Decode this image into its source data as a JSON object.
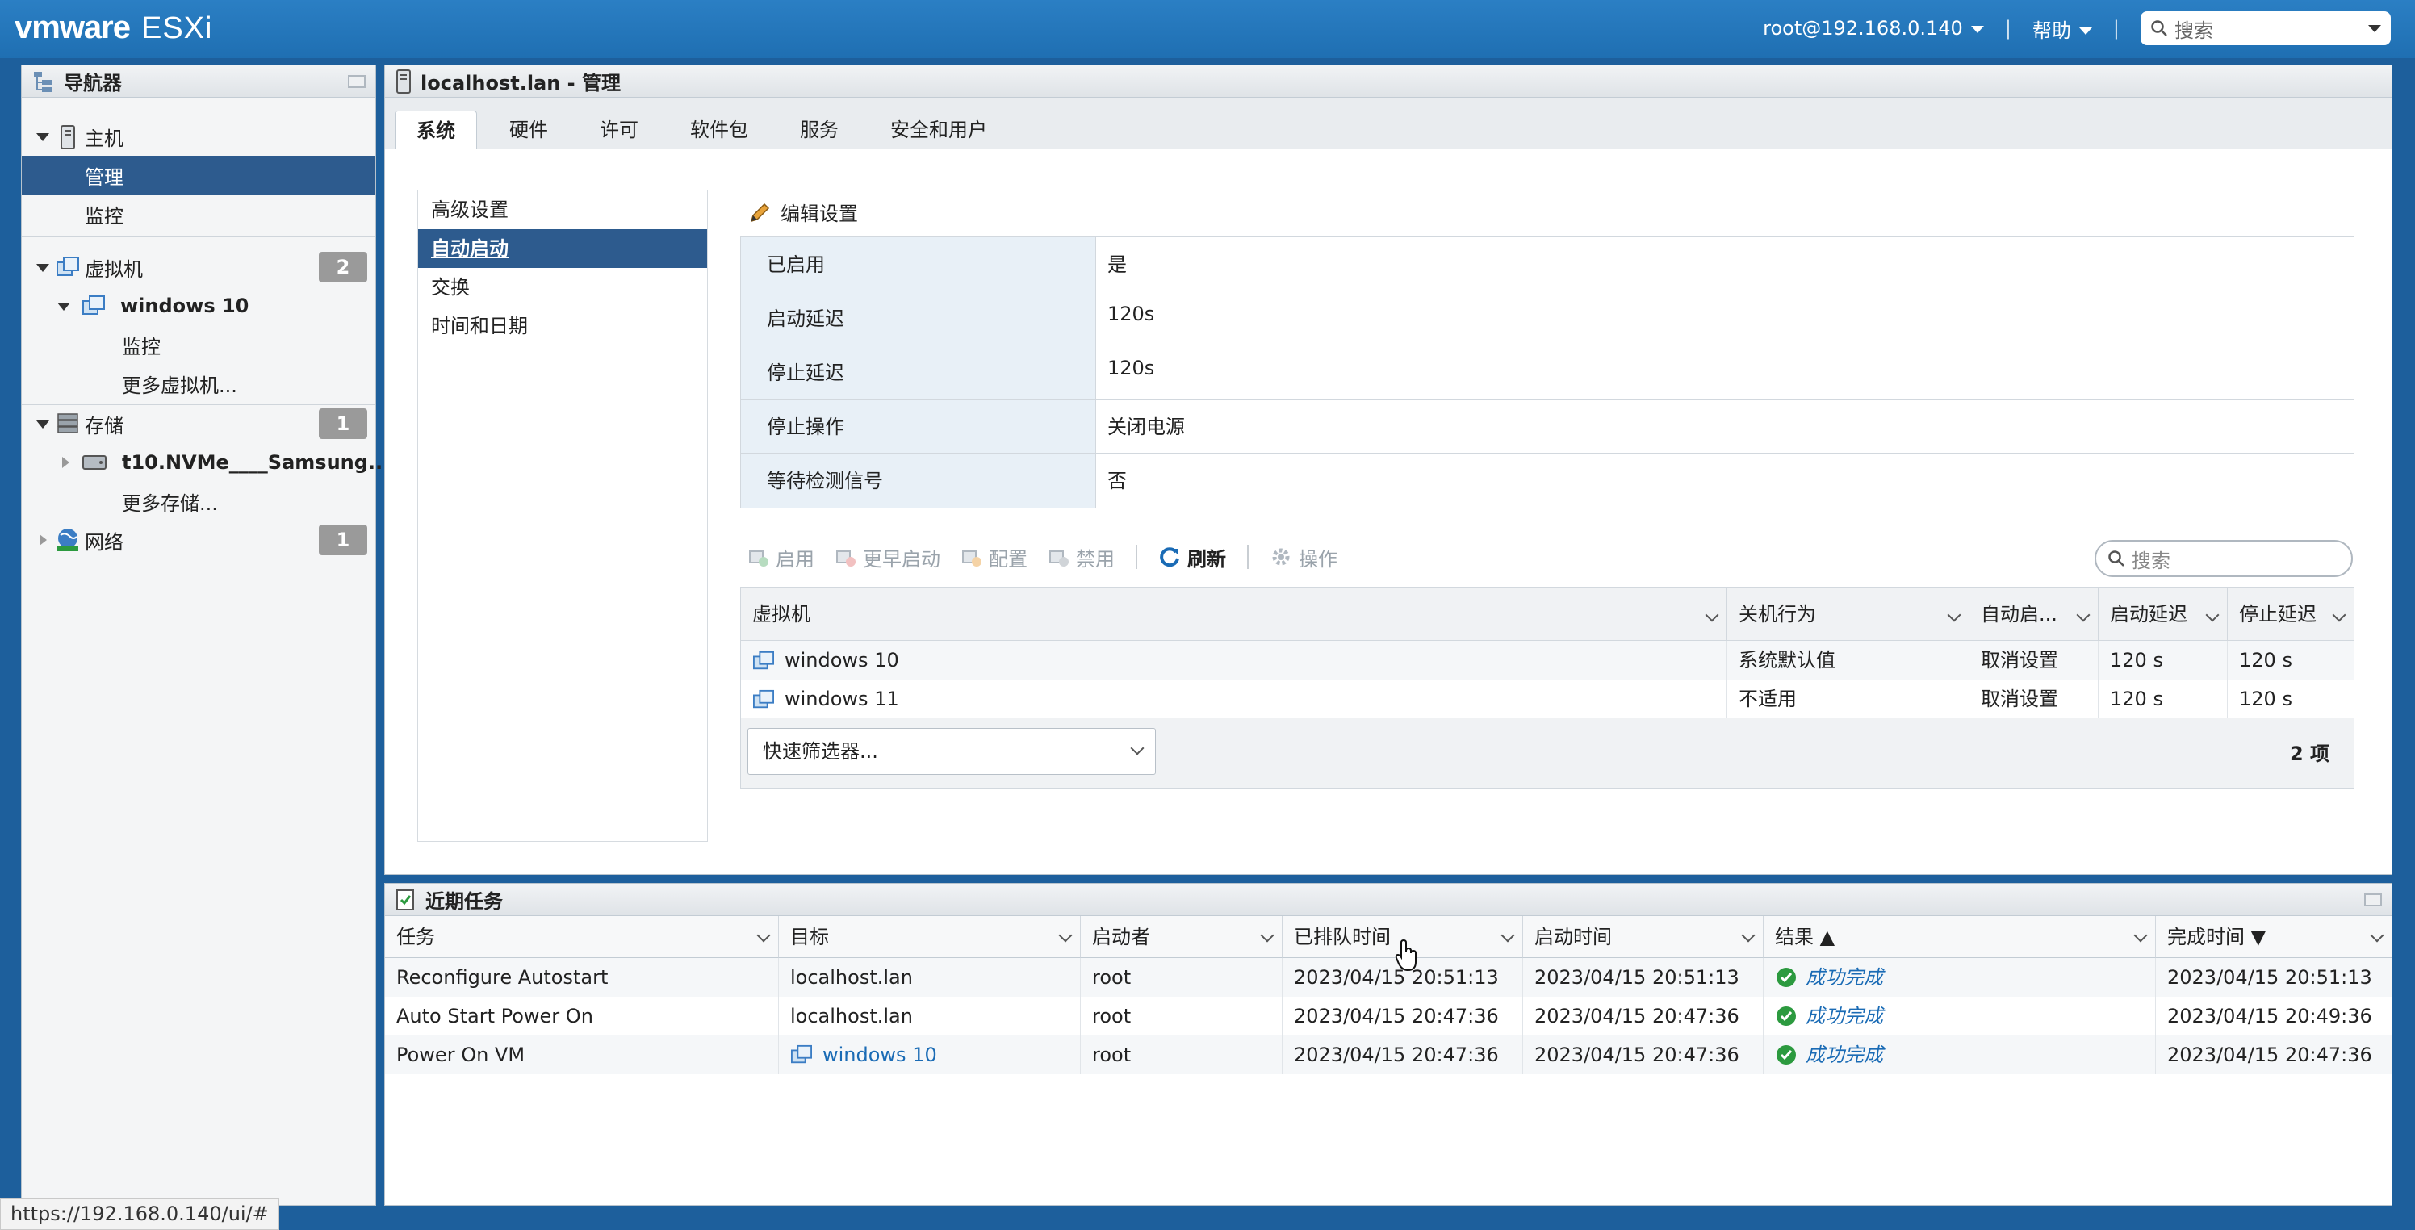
{
  "topbar": {
    "brand": "vmware",
    "product": "ESXi",
    "user": "root@192.168.0.140",
    "help": "帮助",
    "search_placeholder": "搜索"
  },
  "navigator": {
    "title": "导航器",
    "host": {
      "label": "主机",
      "children": [
        "管理",
        "监控"
      ]
    },
    "vms": {
      "label": "虚拟机",
      "count": "2",
      "vm_name": "windows 10",
      "vm_children": [
        "监控"
      ],
      "more": "更多虚拟机..."
    },
    "storage": {
      "label": "存储",
      "count": "1",
      "device": "t10.NVMe____Samsung...",
      "more": "更多存储..."
    },
    "network": {
      "label": "网络",
      "count": "1"
    }
  },
  "main": {
    "title": "localhost.lan - 管理",
    "tabs": [
      "系统",
      "硬件",
      "许可",
      "软件包",
      "服务",
      "安全和用户"
    ],
    "left_menu": [
      "高级设置",
      "自动启动",
      "交换",
      "时间和日期"
    ],
    "edit_settings": "编辑设置",
    "settings": [
      {
        "key": "已启用",
        "value": "是"
      },
      {
        "key": "启动延迟",
        "value": "120s"
      },
      {
        "key": "停止延迟",
        "value": "120s"
      },
      {
        "key": "停止操作",
        "value": "关闭电源"
      },
      {
        "key": "等待检测信号",
        "value": "否"
      }
    ],
    "toolbar": {
      "enable": "启用",
      "start_earlier": "更早启动",
      "configure": "配置",
      "disable": "禁用",
      "refresh": "刷新",
      "actions": "操作",
      "search_placeholder": "搜索"
    },
    "vm_table": {
      "columns": [
        "虚拟机",
        "关机行为",
        "自动启...",
        "启动延迟",
        "停止延迟"
      ],
      "rows": [
        [
          "windows 10",
          "系统默认值",
          "取消设置",
          "120 s",
          "120 s"
        ],
        [
          "windows 11",
          "不适用",
          "取消设置",
          "120 s",
          "120 s"
        ]
      ],
      "quick_filter": "快速筛选器...",
      "count": "2 项"
    }
  },
  "tasks": {
    "title": "近期任务",
    "columns": [
      "任务",
      "目标",
      "启动者",
      "已排队时间",
      "启动时间",
      "结果 ▲",
      "完成时间 ▼"
    ],
    "rows": [
      [
        "Reconfigure Autostart",
        "localhost.lan",
        "root",
        "2023/04/15 20:51:13",
        "2023/04/15 20:51:13",
        "成功完成",
        "2023/04/15 20:51:13"
      ],
      [
        "Auto Start Power On",
        "localhost.lan",
        "root",
        "2023/04/15 20:47:36",
        "2023/04/15 20:47:36",
        "成功完成",
        "2023/04/15 20:49:36"
      ],
      [
        "Power On VM",
        "windows 10",
        "root",
        "2023/04/15 20:47:36",
        "2023/04/15 20:47:36",
        "成功完成",
        "2023/04/15 20:47:36"
      ]
    ]
  },
  "status_url": "https://192.168.0.140/ui/#"
}
